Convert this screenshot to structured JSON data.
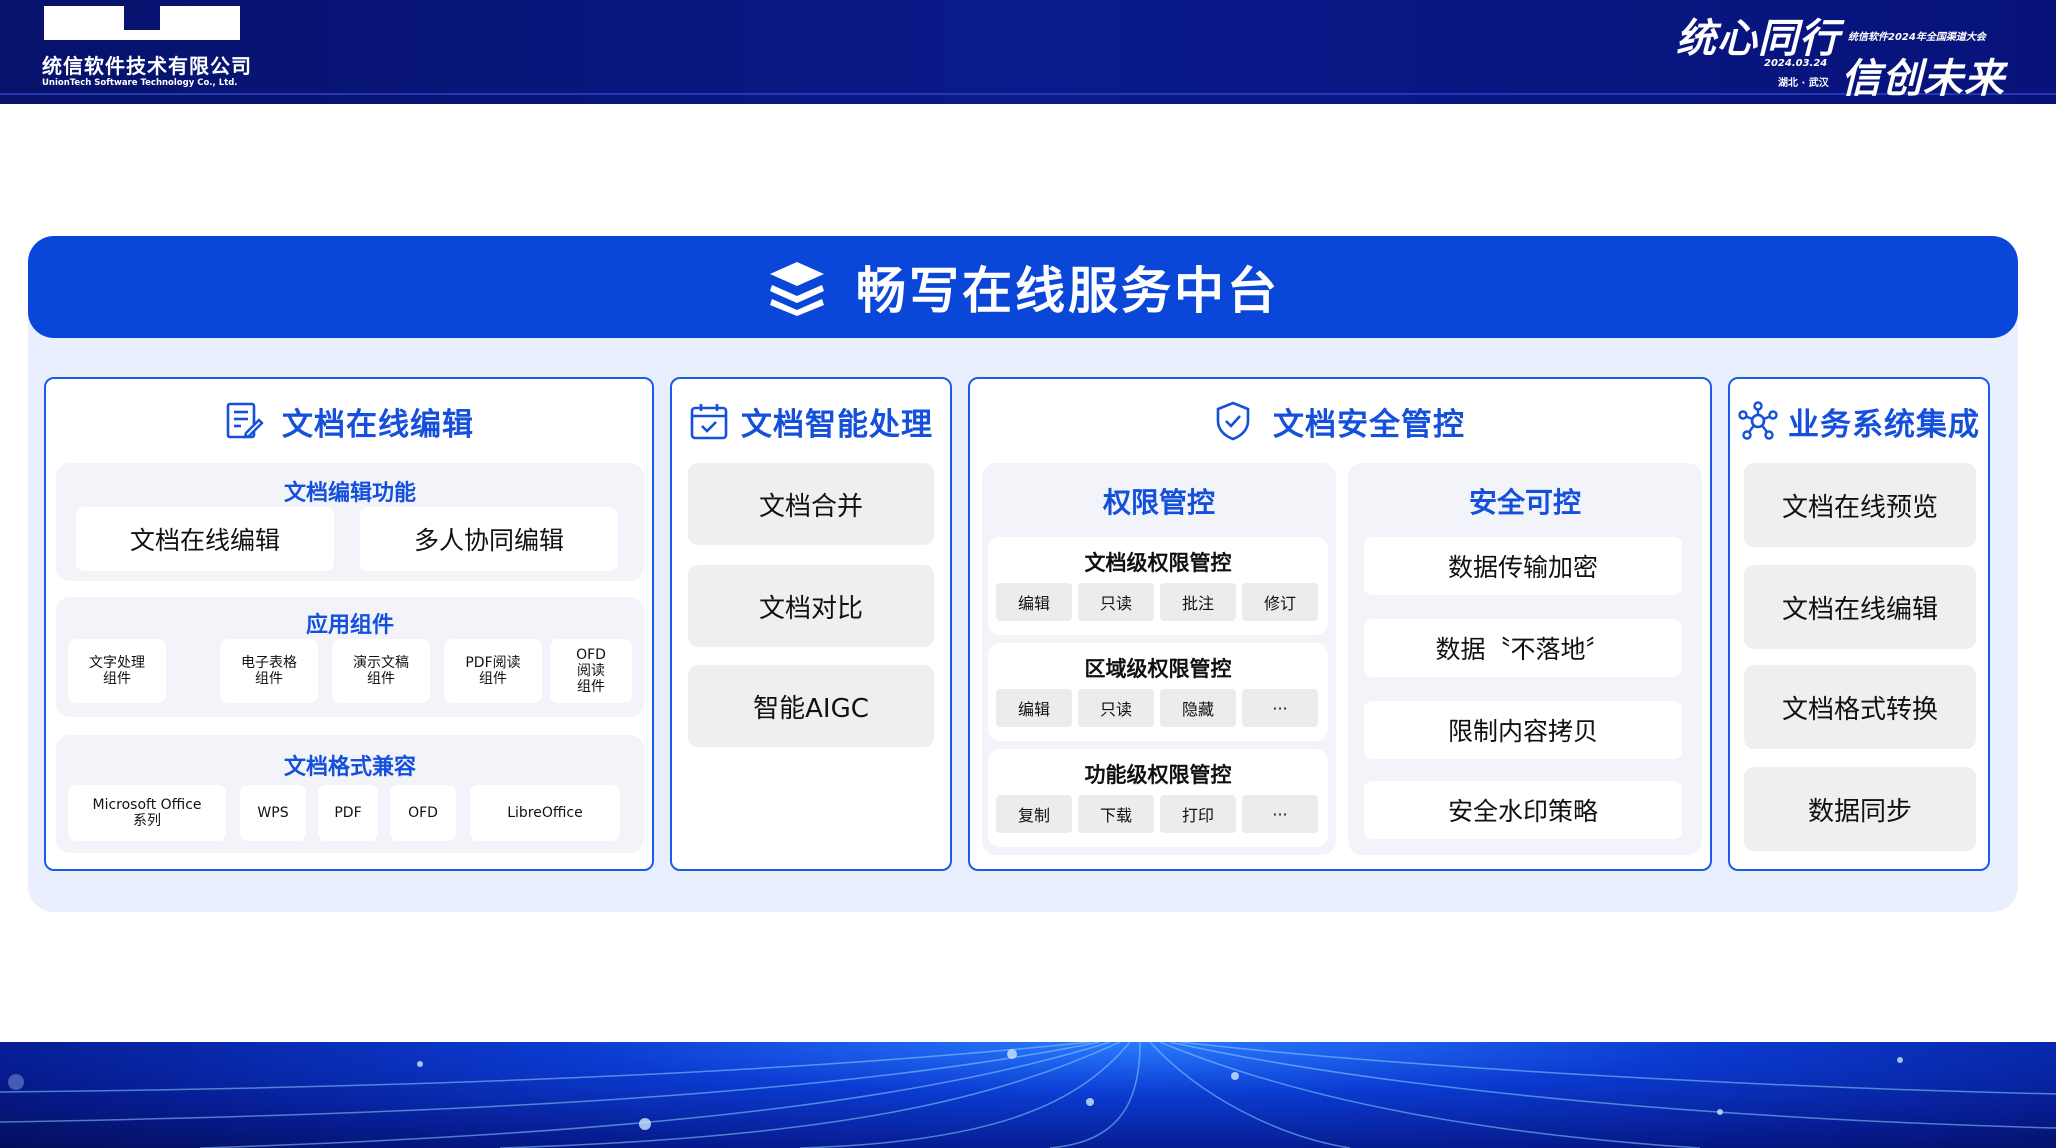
{
  "header": {
    "company_cn": "统信软件技术有限公司",
    "company_en": "UnionTech Software Technology Co., Ltd.",
    "slogan_line1": "统心同行",
    "slogan_line2": "信创未来",
    "event": "统信软件2024年全国渠道大会",
    "date": "2024.03.24",
    "location": "湖北 · 武汉"
  },
  "banner": {
    "title": "畅写在线服务中台",
    "icon": "layers-icon"
  },
  "columns": {
    "edit": {
      "title": "文档在线编辑",
      "icon": "edit-document-icon",
      "groups": {
        "features": {
          "title": "文档编辑功能",
          "items": [
            "文档在线编辑",
            "多人协同编辑"
          ]
        },
        "components": {
          "title": "应用组件",
          "items": [
            "文字处理组件",
            "电子表格组件",
            "演示文稿组件",
            "PDF阅读组件",
            "OFD阅读组件"
          ]
        },
        "formats": {
          "title": "文档格式兼容",
          "items": [
            "Microsoft Office系列",
            "WPS",
            "PDF",
            "OFD",
            "LibreOffice"
          ]
        }
      }
    },
    "smart": {
      "title": "文档智能处理",
      "icon": "calendar-check-icon",
      "items": [
        "文档合并",
        "文档对比",
        "智能AIGC"
      ]
    },
    "security": {
      "title": "文档安全管控",
      "icon": "shield-check-icon",
      "permission": {
        "title": "权限管控",
        "blocks": [
          {
            "title": "文档级权限管控",
            "tags": [
              "编辑",
              "只读",
              "批注",
              "修订"
            ]
          },
          {
            "title": "区域级权限管控",
            "tags": [
              "编辑",
              "只读",
              "隐藏",
              "···"
            ]
          },
          {
            "title": "功能级权限管控",
            "tags": [
              "复制",
              "下载",
              "打印",
              "···"
            ]
          }
        ]
      },
      "safe": {
        "title": "安全可控",
        "items": [
          "数据传输加密",
          "数据〝不落地〞",
          "限制内容拷贝",
          "安全水印策略"
        ]
      }
    },
    "integration": {
      "title": "业务系统集成",
      "icon": "network-hub-icon",
      "items": [
        "文档在线预览",
        "文档在线编辑",
        "文档格式转换",
        "数据同步"
      ]
    }
  },
  "colors": {
    "brand_blue": "#0a47d8",
    "heading_blue": "#1450dc",
    "header_navy": "#06126b",
    "panel_bg": "#e9effd"
  }
}
